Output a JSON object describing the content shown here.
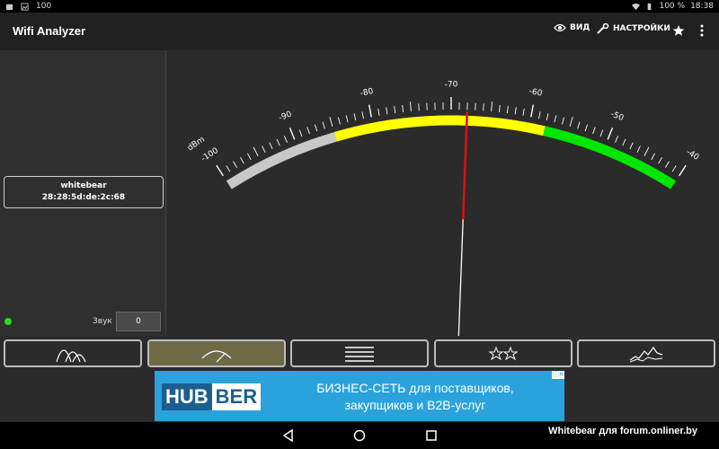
{
  "status_bar": {
    "left_number": "100",
    "battery": "100 %",
    "time": "18:38"
  },
  "app_bar": {
    "title": "Wifi Analyzer",
    "view_label": "ВИД",
    "settings_label": "НАСТРОЙКИ"
  },
  "left_panel": {
    "network_name": "whitebear",
    "network_mac": "28:28:5d:de:2c:68",
    "sound_label": "Звук",
    "sound_value": "0"
  },
  "meter": {
    "unit_label": "dBm",
    "min": -100,
    "max": -40,
    "value": -68,
    "tick_labels": [
      "-100",
      "-90",
      "-80",
      "-70",
      "-60",
      "-50",
      "-40"
    ],
    "zones": [
      {
        "from": -100,
        "to": -85,
        "color": "#c8c8c8"
      },
      {
        "from": -85,
        "to": -58,
        "color": "#ffff00"
      },
      {
        "from": -58,
        "to": -40,
        "color": "#00e600"
      }
    ],
    "needle_color": "#dd1111"
  },
  "tabs": [
    {
      "name": "channel-graph",
      "active": false
    },
    {
      "name": "signal-meter",
      "active": true
    },
    {
      "name": "ap-list",
      "active": false
    },
    {
      "name": "channel-rating",
      "active": false
    },
    {
      "name": "time-graph",
      "active": false
    }
  ],
  "ad": {
    "logo_part1": "HUB",
    "logo_part2": "BER",
    "text_line1": "БИЗНЕС-СЕТЬ для поставщиков,",
    "text_line2": "закупщиков и B2B-услуг"
  },
  "watermark": "Whitebear для forum.onliner.by",
  "colors": {
    "background": "#2b2b2b",
    "app_bar": "#212121",
    "active_tab": "#6e6a48",
    "ad_bg": "#2aa3dc",
    "led": "#22dd22"
  }
}
